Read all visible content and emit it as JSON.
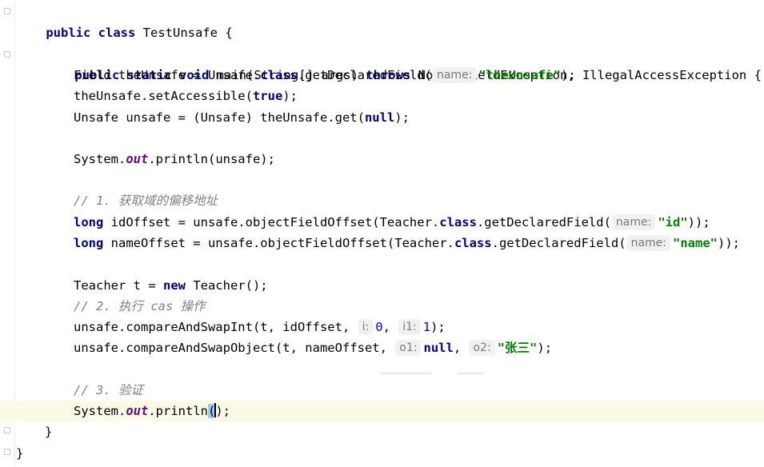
{
  "code": {
    "class_decl": {
      "kw1": "public",
      "kw2": "class",
      "rest": " TestUnsafe {"
    },
    "main_decl": {
      "kw1": "public",
      "kw2": "static",
      "kw3": "void",
      "name": " main(String[] args) ",
      "kw4": "throws",
      "rest": " NoSuchFieldException, IllegalAccessException {"
    },
    "line_field": {
      "a": "Field theUnsafe = Unsafe.",
      "kw": "class",
      "b": ".getDeclaredField(",
      "hint": "name:",
      "str": "\"theUnsafe\"",
      "c": ");"
    },
    "line_accessible": {
      "a": "theUnsafe.setAccessible(",
      "kw": "true",
      "b": ");"
    },
    "line_unsafe": {
      "a": "Unsafe unsafe = (Unsafe) theUnsafe.get(",
      "kw": "null",
      "b": ");"
    },
    "line_print1": {
      "a": "System.",
      "field": "out",
      "b": ".println(unsafe);"
    },
    "comment1": "// 1. 获取域的偏移地址",
    "line_idoffset": {
      "kw": "long",
      "a": " idOffset = unsafe.objectFieldOffset(Teacher.",
      "kw2": "class",
      "b": ".getDeclaredField(",
      "hint": "name:",
      "str": "\"id\"",
      "c": "));"
    },
    "line_nameoffset": {
      "kw": "long",
      "a": " nameOffset = unsafe.objectFieldOffset(Teacher.",
      "kw2": "class",
      "b": ".getDeclaredField(",
      "hint": "name:",
      "str": "\"name\"",
      "c": "));"
    },
    "line_teacher": {
      "a": "Teacher t = ",
      "kw": "new",
      "b": " Teacher();"
    },
    "comment2": "// 2. 执行 cas 操作",
    "line_casint": {
      "a": "unsafe.compareAndSwapInt(t, idOffset, ",
      "hint1": "i:",
      "num1": "0",
      "sep": ", ",
      "hint2": "i1:",
      "num2": "1",
      "b": ");"
    },
    "line_casobj": {
      "a": "unsafe.compareAndSwapObject(t, nameOffset, ",
      "hint1": "o1:",
      "kw": "null",
      "sep": ", ",
      "hint2": "o2:",
      "str": "\"张三\"",
      "b": ");"
    },
    "comment3": "// 3. 验证",
    "line_print2": {
      "a": "System.",
      "field": "out",
      "b": ".println",
      "paren": "(",
      "c": ");"
    },
    "close_method": "}",
    "close_class": "}"
  }
}
